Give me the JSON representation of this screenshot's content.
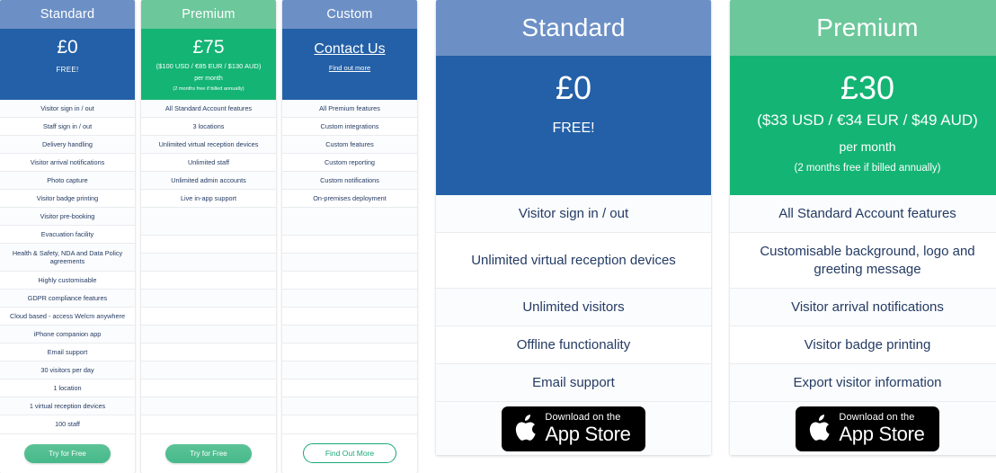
{
  "colors": {
    "blue_header": "#6c90c6",
    "blue_body": "#2460a7",
    "green_header": "#6cc79b",
    "green_body": "#14b474",
    "feature_text": "#243b63",
    "cta_green": "#46b98a",
    "outline_green": "#1aa877"
  },
  "small_cards": [
    {
      "title": "Standard",
      "price_main": "£0",
      "price_free": "FREE!",
      "features": [
        "Visitor sign in / out",
        "Staff sign in / out",
        "Delivery handling",
        "Visitor arrival notifications",
        "Photo capture",
        "Visitor badge printing",
        "Visitor pre-booking",
        "Evacuation facility",
        "Health & Safety, NDA and Data Policy agreements",
        "Highly customisable",
        "GDPR compliance features",
        "Cloud based - access Welcm anywhere",
        "iPhone companion app",
        "Email support",
        "30 visitors per day",
        "1 location",
        "1 virtual reception devices",
        "100 staff"
      ],
      "cta": "Try for Free"
    },
    {
      "title": "Premium",
      "price_main": "£75",
      "price_sub": "($100 USD / €85 EUR / $130 AUD)",
      "price_note": "per month",
      "price_note2": "(2 months free if billed annually)",
      "features": [
        "All Standard Account features",
        "3 locations",
        "Unlimited virtual reception devices",
        "Unlimited staff",
        "Unlimited admin accounts",
        "Live in-app support"
      ],
      "cta": "Try for Free"
    },
    {
      "title": "Custom",
      "contact": "Contact Us",
      "findout": "Find out more",
      "features": [
        "All Premium features",
        "Custom integrations",
        "Custom features",
        "Custom reporting",
        "Custom notifications",
        "On-premises deployment"
      ],
      "cta": "Find Out More"
    }
  ],
  "big_cards": [
    {
      "title": "Standard",
      "price_main": "£0",
      "price_free": "FREE!",
      "features": [
        "Visitor sign in / out",
        "Unlimited virtual reception devices",
        "Unlimited visitors",
        "Offline functionality",
        "Email support"
      ],
      "store": {
        "line1": "Download on the",
        "line2": "App Store"
      }
    },
    {
      "title": "Premium",
      "price_main": "£30",
      "price_sub": "($33 USD / €34 EUR / $49 AUD)",
      "price_note": "per month",
      "price_note2": "(2 months free if billed annually)",
      "features": [
        "All Standard Account features",
        "Customisable background, logo and greeting message",
        "Visitor arrival notifications",
        "Visitor badge printing",
        "Export visitor information"
      ],
      "store": {
        "line1": "Download on the",
        "line2": "App Store"
      }
    }
  ]
}
